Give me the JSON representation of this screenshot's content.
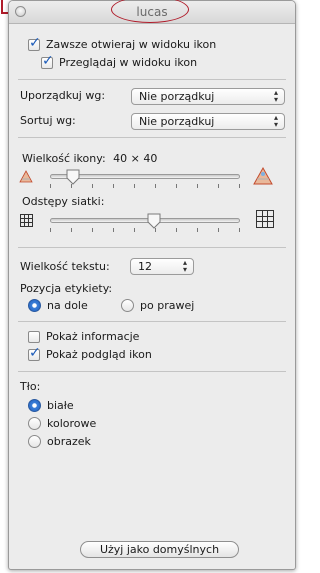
{
  "window": {
    "title": "lucas"
  },
  "options": {
    "always_open_icon_view": {
      "label": "Zawsze otwieraj w widoku ikon",
      "checked": true
    },
    "browse_icon_view": {
      "label": "Przeglądaj w widoku ikon",
      "checked": true
    }
  },
  "arrange": {
    "label": "Uporządkuj wg:",
    "value": "Nie porządkuj"
  },
  "sort": {
    "label": "Sortuj wg:",
    "value": "Nie porządkuj"
  },
  "icon_size": {
    "label": "Wielkość ikony:",
    "value": "40 × 40",
    "level": 0.12
  },
  "grid_spacing": {
    "label": "Odstępy siatki:",
    "level": 0.5
  },
  "text_size": {
    "label": "Wielkość tekstu:",
    "value": "12"
  },
  "label_position": {
    "label": "Pozycja etykiety:",
    "options": [
      {
        "label": "na dole",
        "selected": true
      },
      {
        "label": "po prawej",
        "selected": false
      }
    ]
  },
  "show_info": {
    "label": "Pokaż informacje",
    "checked": false
  },
  "show_icon_preview": {
    "label": "Pokaż podgląd ikon",
    "checked": true
  },
  "background": {
    "label": "Tło:",
    "options": [
      {
        "label": "białe",
        "selected": true
      },
      {
        "label": "kolorowe",
        "selected": false
      },
      {
        "label": "obrazek",
        "selected": false
      }
    ]
  },
  "default_button": {
    "label": "Użyj jako domyślnych"
  },
  "colors": {
    "accent": "#1f5fbf",
    "annotation": "#b01c2a"
  }
}
